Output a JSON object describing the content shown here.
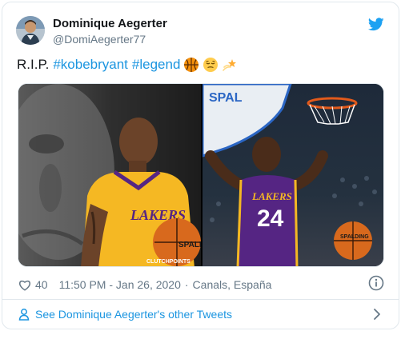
{
  "author": {
    "name": "Dominique Aegerter",
    "handle": "@DomiAegerter77"
  },
  "tweet": {
    "prefix": "R.I.P.",
    "hashtags": [
      "#kobebryant",
      "#legend"
    ],
    "emoji": [
      "basketball-emoji",
      "relieved-face-emoji",
      "dizzy-star-emoji"
    ]
  },
  "media": {
    "left_watermark": "CLUTCHPOINTS",
    "left_jersey_text": "LAKERS",
    "left_ball_text": "SPALD",
    "right_jersey_text": "LAKERS",
    "right_jersey_number": "24",
    "right_ball_text": "SPALDING",
    "right_backboard_text": "SPAL"
  },
  "meta": {
    "likes": "40",
    "time": "11:50 PM - Jan 26, 2020",
    "separator": "·",
    "location": "Canals, España"
  },
  "footer": {
    "link_label": "See Dominique Aegerter's other Tweets"
  },
  "colors": {
    "link": "#1b95e0",
    "secondary_text": "#657786",
    "border": "#e1e8ed",
    "lakers_gold": "#f5b823",
    "lakers_purple": "#552583"
  }
}
